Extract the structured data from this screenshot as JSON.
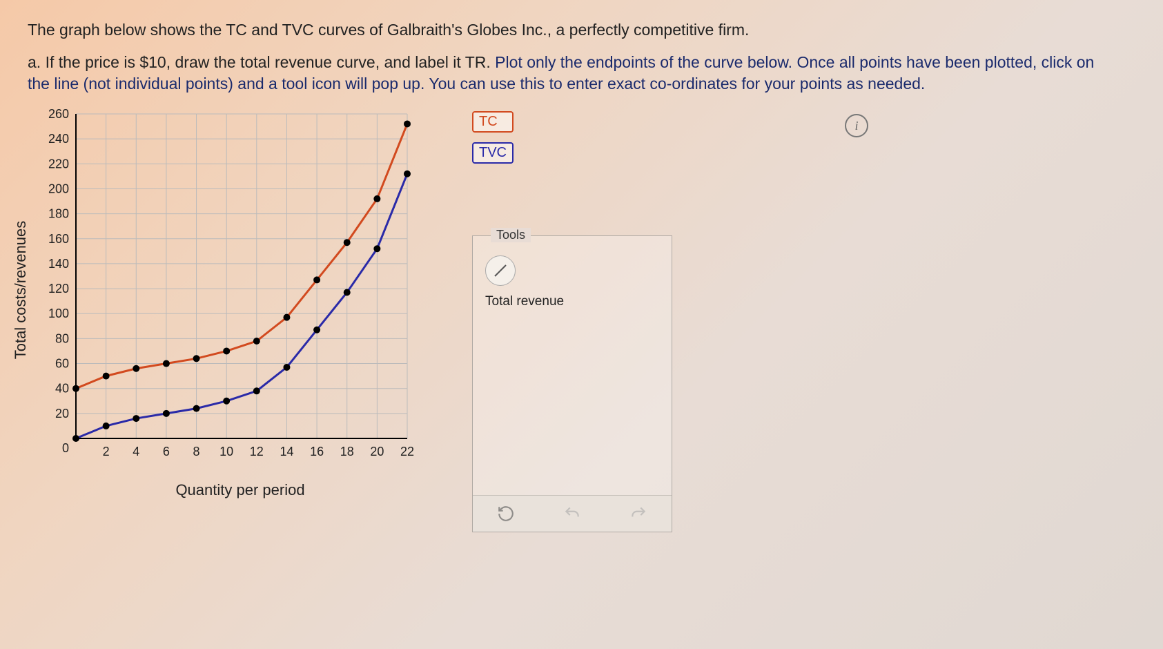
{
  "intro": "The graph below shows the TC and TVC curves of Galbraith's Globes Inc., a perfectly competitive firm.",
  "instruction": {
    "dark1": "a. If the price is $10, draw the total revenue curve, and label it TR.",
    "blue1": " Plot only the endpoints of the curve below. Once all points have been plotted, click on the line (not individual points) and a tool icon will pop up. You can use this to enter exact co-ordinates for your points as needed."
  },
  "legend": {
    "tc": "TC",
    "tvc": "TVC"
  },
  "info_glyph": "i",
  "tools": {
    "title": "Tools",
    "tool_label": "Total revenue"
  },
  "chart_data": {
    "type": "line",
    "xlabel": "Quantity per period",
    "ylabel": "Total costs/revenues",
    "xlim": [
      0,
      22
    ],
    "ylim": [
      0,
      260
    ],
    "x_ticks": [
      2,
      4,
      6,
      8,
      10,
      12,
      14,
      16,
      18,
      20,
      22
    ],
    "y_ticks": [
      20,
      40,
      60,
      80,
      100,
      120,
      140,
      160,
      180,
      200,
      220,
      240,
      260
    ],
    "x": [
      0,
      2,
      4,
      6,
      8,
      10,
      12,
      14,
      16,
      18,
      20,
      22
    ],
    "series": [
      {
        "name": "TC",
        "color": "#d24a1f",
        "values": [
          40,
          50,
          56,
          60,
          64,
          70,
          78,
          97,
          127,
          157,
          192,
          252
        ]
      },
      {
        "name": "TVC",
        "color": "#2a2aa8",
        "values": [
          0,
          10,
          16,
          20,
          24,
          30,
          38,
          57,
          87,
          117,
          152,
          212
        ]
      }
    ]
  }
}
